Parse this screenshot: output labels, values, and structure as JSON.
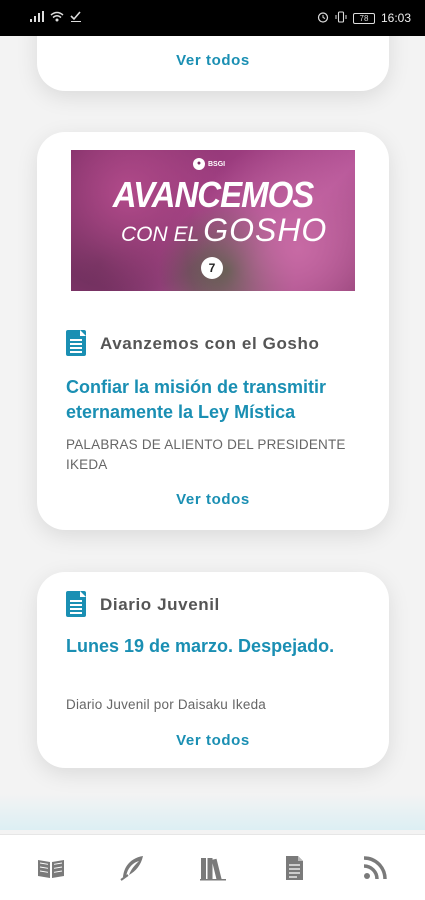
{
  "status_bar": {
    "left_icons": [
      "signal-icon",
      "wifi-icon",
      "check-icon"
    ],
    "battery": "78",
    "time": "16:03"
  },
  "cards": {
    "top": {
      "ver_todos": "Ver todos"
    },
    "main": {
      "banner": {
        "logo": "BSGI",
        "title_line1": "AVANCEMOS",
        "title_con_el": "CON EL",
        "title_gosho": "GOSHO",
        "number": "7"
      },
      "section": "Avanzemos con el Gosho",
      "headline": "Confiar la misión de transmitir eternamente la Ley Mística",
      "subtext": "PALABRAS DE ALIENTO DEL PRESIDENTE IKEDA",
      "ver_todos": "Ver todos"
    },
    "diario": {
      "section": "Diario Juvenil",
      "headline": "Lunes 19 de marzo. Despejado.",
      "subtext": "Diario Juvenil por Daisaku Ikeda",
      "ver_todos": "Ver todos"
    }
  },
  "bottom_nav": [
    "book-open-icon",
    "quill-icon",
    "library-icon",
    "document-icon",
    "rss-icon"
  ],
  "colors": {
    "accent": "#1a8fb3",
    "status_bar": "#000000",
    "nav_icon": "#7a7a7a"
  }
}
